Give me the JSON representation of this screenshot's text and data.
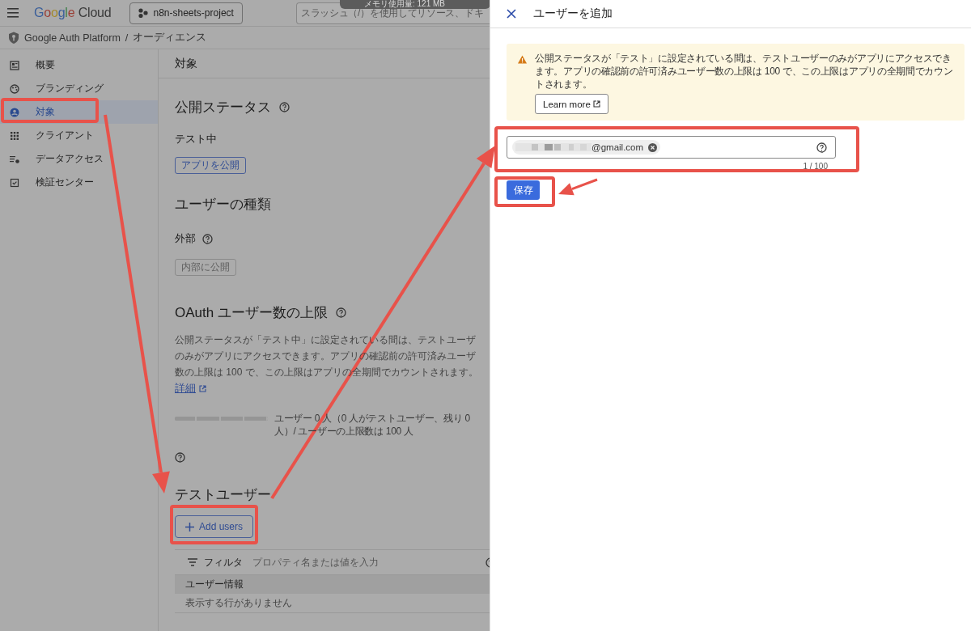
{
  "topbar": {
    "app_name": "Google Cloud",
    "project": "n8n-sheets-project",
    "search_placeholder": "スラッシュ（/）を使用してリソース、ドキ"
  },
  "tooltip": "メモリ使用量: 121 MB",
  "breadcrumb": {
    "product": "Google Auth Platform",
    "separator": "/",
    "page": "オーディエンス"
  },
  "sidebar": {
    "items": [
      {
        "label": "概要",
        "selected": false
      },
      {
        "label": "ブランディング",
        "selected": false
      },
      {
        "label": "対象",
        "selected": true
      },
      {
        "label": "クライアント",
        "selected": false
      },
      {
        "label": "データアクセス",
        "selected": false
      },
      {
        "label": "検証センター",
        "selected": false
      }
    ]
  },
  "main": {
    "title": "対象",
    "publishing": {
      "heading": "公開ステータス",
      "status": "テスト中",
      "button": "アプリを公開"
    },
    "user_type": {
      "heading": "ユーザーの種類",
      "value": "外部",
      "button": {
        "label": "内部に公開",
        "disabled": true
      }
    },
    "limit": {
      "heading": "OAuth ユーザー数の上限",
      "description_lines": [
        "公開ステータスが「テスト中」に設定されている間は、テストユーザ",
        "のみがアプリにアクセスできます。アプリの確認前の許可済みユーザ",
        "数の上限は 100 で、この上限はアプリの全期間でカウントされます。"
      ],
      "link": "詳細",
      "meter_text_lines": [
        "ユーザー 0 人（0 人がテストユーザー、残り 0",
        "人）/ ユーザーの上限数は 100 人"
      ]
    },
    "test_users": {
      "heading": "テストユーザー",
      "add_button": "Add users",
      "filter": {
        "label": "フィルタ",
        "placeholder": "プロパティ名または値を入力"
      },
      "columns": [
        "ユーザー情報"
      ],
      "empty": "表示する行がありません"
    }
  },
  "panel": {
    "title": "ユーザーを追加",
    "alert": {
      "lines": [
        "公開ステータスが「テスト」に設定されている間は、テストユーザーのみがアプリにアクセスでき",
        "ます。アプリの確認前の許可済みユーザー数の上限は 100 で、この上限はアプリの全期間でカウン",
        "トされます。"
      ],
      "button": "Learn more"
    },
    "field": {
      "chips": [
        "@gmail.com"
      ],
      "counter": "1 / 100"
    },
    "save_button": "保存"
  }
}
